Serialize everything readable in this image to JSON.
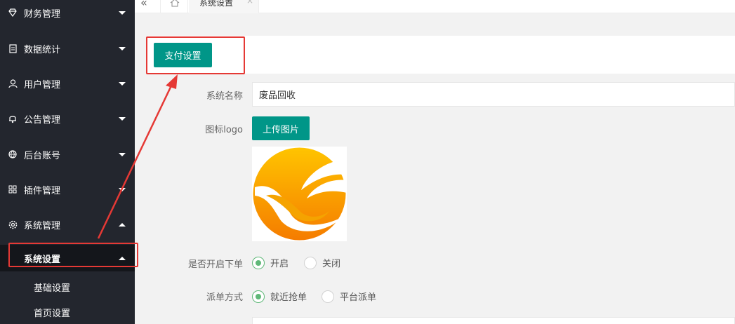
{
  "sidebar": {
    "items": [
      {
        "label": "财务管理",
        "icon": "diamond-icon"
      },
      {
        "label": "数据统计",
        "icon": "clipboard-icon"
      },
      {
        "label": "用户管理",
        "icon": "user-icon"
      },
      {
        "label": "公告管理",
        "icon": "bell-icon"
      },
      {
        "label": "后台账号",
        "icon": "globe-icon"
      },
      {
        "label": "插件管理",
        "icon": "grid-icon"
      },
      {
        "label": "系统管理",
        "icon": "gear-icon"
      }
    ],
    "submenu_title": "系统设置",
    "submenu_items": [
      "基础设置",
      "首页设置"
    ]
  },
  "tabs": {
    "current": "系统设置",
    "close": "×",
    "collapse": "«"
  },
  "main": {
    "pay_button": "支付设置",
    "fields": {
      "name_label": "系统名称",
      "name_value": "废品回收",
      "logo_label": "图标logo",
      "upload_button": "上传图片",
      "order_label": "是否开启下单",
      "order_on": "开启",
      "order_off": "关闭",
      "dispatch_label": "派单方式",
      "dispatch_near": "就近抢单",
      "dispatch_platform": "平台派单"
    }
  },
  "colors": {
    "primary": "#009688",
    "sidebar_bg": "#23262e",
    "radio_checked": "#5fb878",
    "highlight": "#e53935"
  }
}
